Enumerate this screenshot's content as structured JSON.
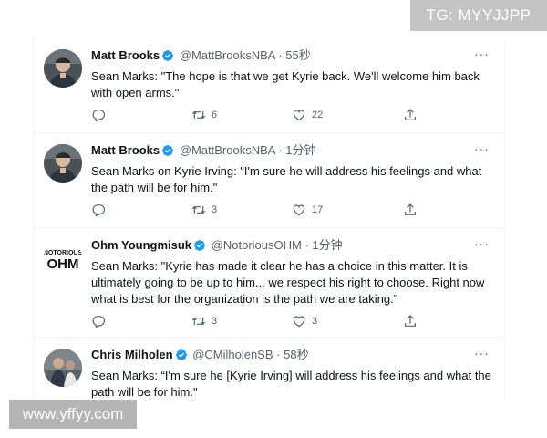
{
  "watermarks": {
    "top": "TG: MYYJJPP",
    "bottom": "www.yffyy.com"
  },
  "tweets": [
    {
      "name": "Matt Brooks",
      "verified": true,
      "handle": "@MattBrooksNBA",
      "separator": "·",
      "time": "55秒",
      "text": "Sean Marks: \"The hope is that we get Kyrie back. We'll welcome him back with open arms.\"",
      "replies": "",
      "retweets": "6",
      "likes": "22",
      "avatar_icon": "person-photo-icon"
    },
    {
      "name": "Matt Brooks",
      "verified": true,
      "handle": "@MattBrooksNBA",
      "separator": "·",
      "time": "1分钟",
      "text": "Sean Marks on Kyrie Irving: \"I'm sure he will address his feelings and what the path will be for him.\"",
      "replies": "",
      "retweets": "3",
      "likes": "17",
      "avatar_icon": "person-photo-icon"
    },
    {
      "name": "Ohm Youngmisuk",
      "verified": true,
      "handle": "@NotoriousOHM",
      "separator": "·",
      "time": "1分钟",
      "text": "Sean Marks: \"Kyrie has made it clear he has a choice in this matter. It is ultimately going to be up to him... we respect his right to choose. Right now what is best for the organization is the path we are taking.\"",
      "replies": "",
      "retweets": "3",
      "likes": "3",
      "avatar_icon": "notorious-ohm-logo-icon",
      "avatar_text_top": "NOTORIOUS",
      "avatar_text_bottom": "OHM"
    },
    {
      "name": "Chris Milholen",
      "verified": true,
      "handle": "@CMilholenSB",
      "separator": "·",
      "time": "58秒",
      "text": "Sean Marks: “I'm sure he [Kyrie Irving] will address his feelings and what the path will be for him.\"",
      "avatar_icon": "person-photo-icon"
    }
  ],
  "colors": {
    "verified": "#1d9bf0",
    "text": "#0f1419",
    "muted": "#536471",
    "divider": "#eff3f4"
  }
}
